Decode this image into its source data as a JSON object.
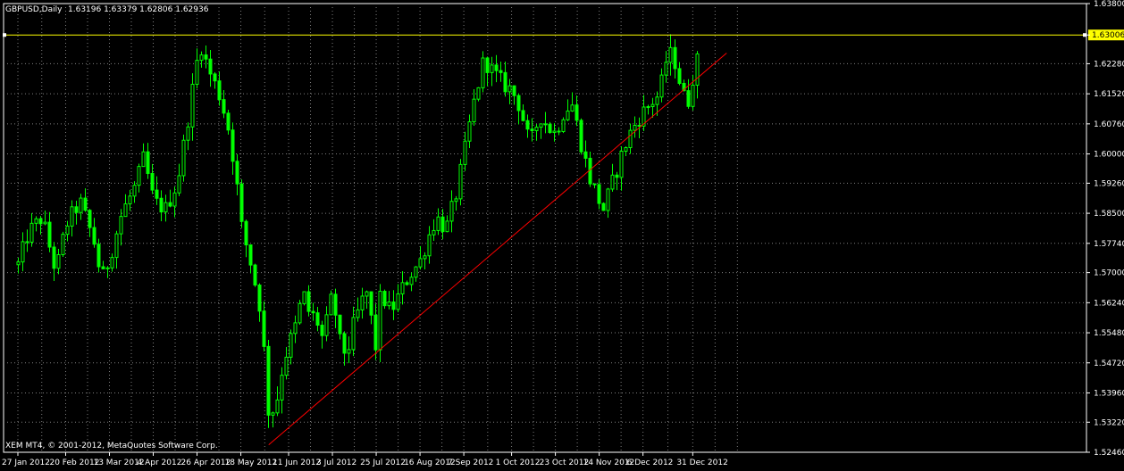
{
  "header": {
    "symbol": "GBPUSD,Daily",
    "ohlc": "1.63196 1.63379 1.62806 1.62936"
  },
  "footer": {
    "copyright": "XEM MT4, © 2001-2012, MetaQuotes Software Corp."
  },
  "colors": {
    "background": "#000000",
    "grid": "#7f7f7f",
    "bull_candle": "#00ff00",
    "bear_candle": "#00ff00",
    "trendline": "#ff0000",
    "hline": "#ffff00",
    "frame": "#ffffff"
  },
  "chart_data": {
    "type": "candlestick",
    "title": "GBPUSD,Daily",
    "ylim": [
      1.5246,
      1.638
    ],
    "y_ticks": [
      "1.63800",
      "1.63006",
      "1.62280",
      "1.61520",
      "1.60760",
      "1.60000",
      "1.59260",
      "1.58500",
      "1.57740",
      "1.57000",
      "1.56240",
      "1.55480",
      "1.54720",
      "1.53960",
      "1.53220",
      "1.52460"
    ],
    "x_ticks": [
      "27 Jan 2012",
      "20 Feb 2012",
      "13 Mar 2012",
      "4 Apr 2012",
      "26 Apr 2012",
      "18 May 2012",
      "11 Jun 2012",
      "3 Jul 2012",
      "25 Jul 2012",
      "16 Aug 2012",
      "7 Sep 2012",
      "1 Oct 2012",
      "23 Oct 2012",
      "14 Nov 2012",
      "6 Dec 2012",
      "31 Dec 2012"
    ],
    "horizontal_line": {
      "price": 1.63006,
      "label": "1.63006"
    },
    "trendline": {
      "from": {
        "date": "2012-06-01",
        "price": 1.5265
      },
      "to": {
        "date": "2013-01-17",
        "price": 1.6255
      }
    },
    "anchor_closes": [
      [
        "2012-01-27",
        1.572
      ],
      [
        "2012-02-01",
        1.58
      ],
      [
        "2012-02-08",
        1.584
      ],
      [
        "2012-02-15",
        1.57
      ],
      [
        "2012-02-20",
        1.582
      ],
      [
        "2012-02-27",
        1.588
      ],
      [
        "2012-03-05",
        1.578
      ],
      [
        "2012-03-09",
        1.568
      ],
      [
        "2012-03-13",
        1.574
      ],
      [
        "2012-03-19",
        1.585
      ],
      [
        "2012-03-26",
        1.592
      ],
      [
        "2012-03-30",
        1.599
      ],
      [
        "2012-04-04",
        1.588
      ],
      [
        "2012-04-10",
        1.586
      ],
      [
        "2012-04-16",
        1.593
      ],
      [
        "2012-04-20",
        1.605
      ],
      [
        "2012-04-26",
        1.624
      ],
      [
        "2012-04-27",
        1.629
      ],
      [
        "2012-05-01",
        1.622
      ],
      [
        "2012-05-07",
        1.615
      ],
      [
        "2012-05-11",
        1.608
      ],
      [
        "2012-05-15",
        1.596
      ],
      [
        "2012-05-18",
        1.582
      ],
      [
        "2012-05-23",
        1.572
      ],
      [
        "2012-05-28",
        1.56
      ],
      [
        "2012-06-01",
        1.533
      ],
      [
        "2012-06-05",
        1.538
      ],
      [
        "2012-06-08",
        1.547
      ],
      [
        "2012-06-11",
        1.552
      ],
      [
        "2012-06-14",
        1.556
      ],
      [
        "2012-06-18",
        1.565
      ],
      [
        "2012-06-21",
        1.56
      ],
      [
        "2012-06-25",
        1.558
      ],
      [
        "2012-06-28",
        1.553
      ],
      [
        "2012-07-03",
        1.565
      ],
      [
        "2012-07-06",
        1.553
      ],
      [
        "2012-07-10",
        1.549
      ],
      [
        "2012-07-13",
        1.556
      ],
      [
        "2012-07-17",
        1.562
      ],
      [
        "2012-07-20",
        1.565
      ],
      [
        "2012-07-25",
        1.55
      ],
      [
        "2012-07-27",
        1.565
      ],
      [
        "2012-08-01",
        1.56
      ],
      [
        "2012-08-06",
        1.565
      ],
      [
        "2012-08-10",
        1.569
      ],
      [
        "2012-08-16",
        1.573
      ],
      [
        "2012-08-20",
        1.579
      ],
      [
        "2012-08-24",
        1.584
      ],
      [
        "2012-08-29",
        1.581
      ],
      [
        "2012-09-03",
        1.59
      ],
      [
        "2012-09-07",
        1.6
      ],
      [
        "2012-09-11",
        1.611
      ],
      [
        "2012-09-17",
        1.624
      ],
      [
        "2012-09-21",
        1.621
      ],
      [
        "2012-09-26",
        1.618
      ],
      [
        "2012-10-01",
        1.616
      ],
      [
        "2012-10-05",
        1.612
      ],
      [
        "2012-10-10",
        1.602
      ],
      [
        "2012-10-15",
        1.61
      ],
      [
        "2012-10-19",
        1.607
      ],
      [
        "2012-10-23",
        1.605
      ],
      [
        "2012-10-26",
        1.61
      ],
      [
        "2012-10-31",
        1.613
      ],
      [
        "2012-11-06",
        1.6
      ],
      [
        "2012-11-09",
        1.594
      ],
      [
        "2012-11-14",
        1.588
      ],
      [
        "2012-11-16",
        1.586
      ],
      [
        "2012-11-20",
        1.592
      ],
      [
        "2012-11-26",
        1.601
      ],
      [
        "2012-11-30",
        1.606
      ],
      [
        "2012-12-05",
        1.61
      ],
      [
        "2012-12-10",
        1.613
      ],
      [
        "2012-12-14",
        1.615
      ],
      [
        "2012-12-18",
        1.625
      ],
      [
        "2012-12-21",
        1.625
      ],
      [
        "2012-12-26",
        1.615
      ],
      [
        "2012-12-28",
        1.612
      ],
      [
        "2012-12-31",
        1.62
      ],
      [
        "2013-01-03",
        1.625
      ]
    ]
  }
}
